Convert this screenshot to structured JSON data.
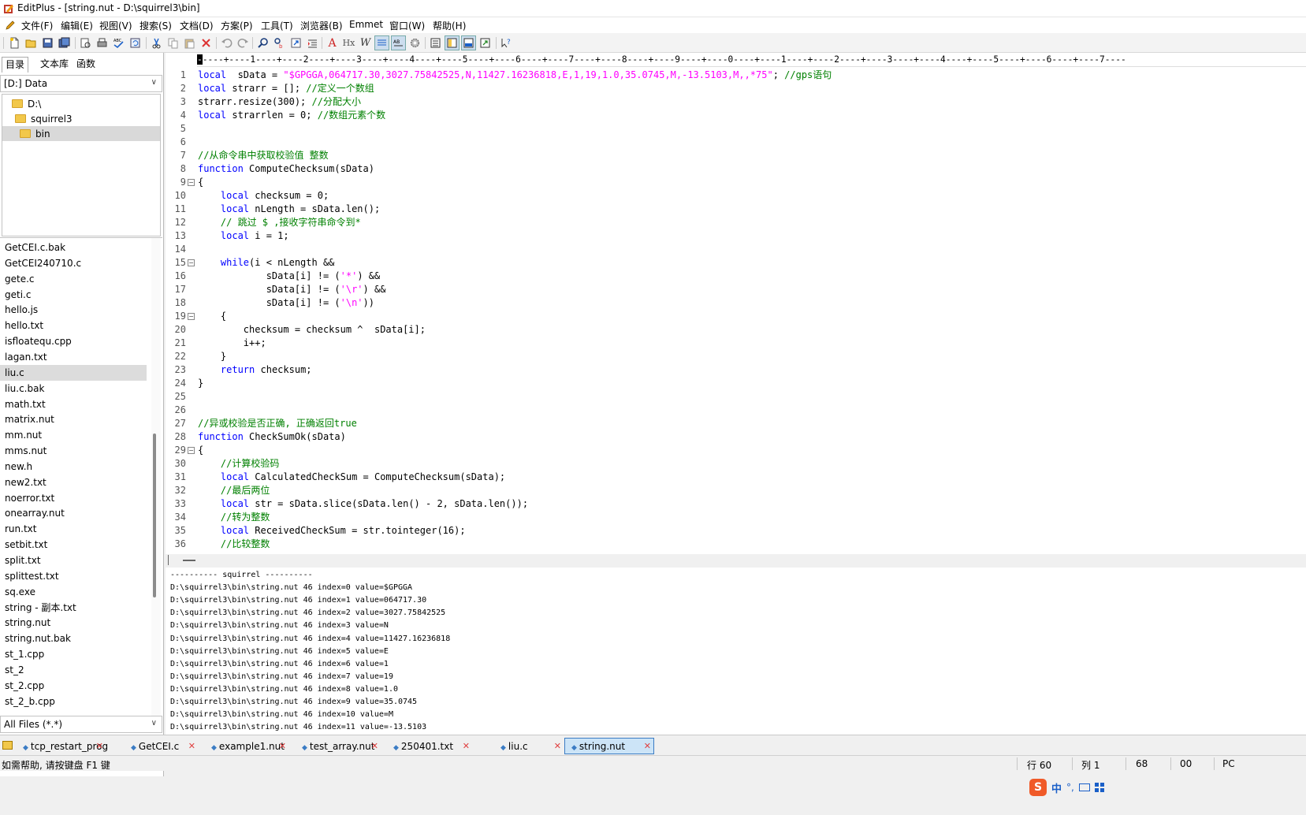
{
  "window": {
    "title": "EditPlus - [string.nut - D:\\squirrel3\\bin]"
  },
  "menu": [
    "文件(F)",
    "编辑(E)",
    "视图(V)",
    "搜索(S)",
    "文档(D)",
    "方案(P)",
    "工具(T)",
    "浏览器(B)",
    "Emmet",
    "窗口(W)",
    "帮助(H)"
  ],
  "toolbar": {
    "icons": [
      "new-file-icon",
      "open-file-icon",
      "save-icon",
      "save-all-icon",
      "print-preview-icon",
      "print-icon",
      "spellcheck-icon",
      "refresh-icon",
      "cut-icon",
      "copy-icon",
      "paste-icon",
      "delete-icon",
      "undo-icon",
      "redo-icon",
      "find-icon",
      "replace-icon",
      "goto-icon",
      "indent-icon",
      "font-icon",
      "hex-icon",
      "word-wrap-icon",
      "line-number-icon",
      "ruler-icon",
      "settings-icon",
      "cliptext-icon",
      "directory-icon",
      "output-icon",
      "fullscreen-icon",
      "help-icon"
    ],
    "labels": {
      "font": "A",
      "hex": "Hx",
      "wrap": "W"
    }
  },
  "left": {
    "tabs": [
      "目录",
      "文本库",
      "函数"
    ],
    "drive": "[D:] Data",
    "tree": [
      {
        "label": "D:\\"
      },
      {
        "label": "squirrel3"
      },
      {
        "label": "bin"
      }
    ],
    "files": [
      "GetCEI.c.bak",
      "GetCEI240710.c",
      "gete.c",
      "geti.c",
      "hello.js",
      "hello.txt",
      "isfloatequ.cpp",
      "lagan.txt",
      "liu.c",
      "liu.c.bak",
      "math.txt",
      "matrix.nut",
      "mm.nut",
      "mms.nut",
      "new.h",
      "new2.txt",
      "noerror.txt",
      "onearray.nut",
      "run.txt",
      "setbit.txt",
      "split.txt",
      "splittest.txt",
      "sq.exe",
      "string - 副本.txt",
      "string.nut",
      "string.nut.bak",
      "st_1.cpp",
      "st_2",
      "st_2.cpp",
      "st_2_b.cpp"
    ],
    "selected_file": "liu.c",
    "filter": "All Files (*.*)"
  },
  "editor": {
    "ruler": "----+----1----+----2----+----3----+----4----+----5----+----6----+----7----+----8----+----9----+----0----+----1----+----2----+----3----+----4----+----5----+----6----+----7----",
    "lines": [
      [
        [
          "kw",
          "local"
        ],
        [
          "",
          "  sData = "
        ],
        [
          "str",
          "\"$GPGGA,064717.30,3027.75842525,N,11427.16236818,E,1,19,1.0,35.0745,M,-13.5103,M,,*75\""
        ],
        [
          "",
          "; "
        ],
        [
          "cm",
          "//gps语句"
        ]
      ],
      [
        [
          "kw",
          "local"
        ],
        [
          "",
          " strarr = []; "
        ],
        [
          "cm",
          "//定义一个数组"
        ]
      ],
      [
        [
          "",
          "strarr.resize(300); "
        ],
        [
          "cm",
          "//分配大小"
        ]
      ],
      [
        [
          "kw",
          "local"
        ],
        [
          "",
          " strarrlen = 0; "
        ],
        [
          "cm",
          "//数组元素个数"
        ]
      ],
      [],
      [],
      [
        [
          "cm",
          "//从命令串中获取校验值 整数"
        ]
      ],
      [
        [
          "kw",
          "function"
        ],
        [
          "",
          " ComputeChecksum(sData)"
        ]
      ],
      [
        [
          "",
          "{"
        ]
      ],
      [
        [
          "",
          "    "
        ],
        [
          "kw",
          "local"
        ],
        [
          "",
          " checksum = 0;"
        ]
      ],
      [
        [
          "",
          "    "
        ],
        [
          "kw",
          "local"
        ],
        [
          "",
          " nLength = sData.len();"
        ]
      ],
      [
        [
          "",
          "    "
        ],
        [
          "cm",
          "// 跳过 $ ,接收字符串命令到*"
        ]
      ],
      [
        [
          "",
          "    "
        ],
        [
          "kw",
          "local"
        ],
        [
          "",
          " i = 1;"
        ]
      ],
      [],
      [
        [
          "",
          "    "
        ],
        [
          "kw",
          "while"
        ],
        [
          "",
          "(i < nLength &&"
        ]
      ],
      [
        [
          "",
          "            sData[i] != ("
        ],
        [
          "str",
          "'*'"
        ],
        [
          "",
          ") &&"
        ]
      ],
      [
        [
          "",
          "            sData[i] != ("
        ],
        [
          "str",
          "'\\r'"
        ],
        [
          "",
          ") &&"
        ]
      ],
      [
        [
          "",
          "            sData[i] != ("
        ],
        [
          "str",
          "'\\n'"
        ],
        [
          "",
          "))"
        ]
      ],
      [
        [
          "",
          "    {"
        ]
      ],
      [
        [
          "",
          "        checksum = checksum ^  sData[i];"
        ]
      ],
      [
        [
          "",
          "        i++;"
        ]
      ],
      [
        [
          "",
          "    }"
        ]
      ],
      [
        [
          "",
          "    "
        ],
        [
          "kw",
          "return"
        ],
        [
          "",
          " checksum;"
        ]
      ],
      [
        [
          "",
          "}"
        ]
      ],
      [],
      [],
      [
        [
          "cm",
          "//异或校验是否正确, 正确返回true"
        ]
      ],
      [
        [
          "kw",
          "function"
        ],
        [
          "",
          " CheckSumOk(sData)"
        ]
      ],
      [
        [
          "",
          "{"
        ]
      ],
      [
        [
          "",
          "    "
        ],
        [
          "cm",
          "//计算校验码"
        ]
      ],
      [
        [
          "",
          "    "
        ],
        [
          "kw",
          "local"
        ],
        [
          "",
          " CalculatedCheckSum = ComputeChecksum(sData);"
        ]
      ],
      [
        [
          "",
          "    "
        ],
        [
          "cm",
          "//最后两位"
        ]
      ],
      [
        [
          "",
          "    "
        ],
        [
          "kw",
          "local"
        ],
        [
          "",
          " str = sData.slice(sData.len() - 2, sData.len());"
        ]
      ],
      [
        [
          "",
          "    "
        ],
        [
          "cm",
          "//转为整数"
        ]
      ],
      [
        [
          "",
          "    "
        ],
        [
          "kw",
          "local"
        ],
        [
          "",
          " ReceivedCheckSum = str.tointeger(16);"
        ]
      ],
      [
        [
          "",
          "    "
        ],
        [
          "cm",
          "//比较整数"
        ]
      ]
    ],
    "fold_lines": [
      9,
      15,
      19,
      29
    ]
  },
  "output": [
    "---------- squirrel ----------",
    "D:\\squirrel3\\bin\\string.nut 46 index=0 value=$GPGGA",
    "D:\\squirrel3\\bin\\string.nut 46 index=1 value=064717.30",
    "D:\\squirrel3\\bin\\string.nut 46 index=2 value=3027.75842525",
    "D:\\squirrel3\\bin\\string.nut 46 index=3 value=N",
    "D:\\squirrel3\\bin\\string.nut 46 index=4 value=11427.16236818",
    "D:\\squirrel3\\bin\\string.nut 46 index=5 value=E",
    "D:\\squirrel3\\bin\\string.nut 46 index=6 value=1",
    "D:\\squirrel3\\bin\\string.nut 46 index=7 value=19",
    "D:\\squirrel3\\bin\\string.nut 46 index=8 value=1.0",
    "D:\\squirrel3\\bin\\string.nut 46 index=9 value=35.0745",
    "D:\\squirrel3\\bin\\string.nut 46 index=10 value=M",
    "D:\\squirrel3\\bin\\string.nut 46 index=11 value=-13.5103"
  ],
  "tabs": [
    {
      "label": "tcp_restart_prog",
      "active": false
    },
    {
      "label": "GetCEI.c",
      "active": false
    },
    {
      "label": "example1.nut",
      "active": false
    },
    {
      "label": "test_array.nut",
      "active": false
    },
    {
      "label": "250401.txt",
      "active": false
    },
    {
      "label": "liu.c",
      "active": false
    },
    {
      "label": "string.nut",
      "active": true
    }
  ],
  "status": {
    "help": "如需帮助, 请按键盘 F1 键",
    "row": "行 60",
    "col": "列 1",
    "v1": "68",
    "v2": "00",
    "mode": "PC"
  },
  "ime": {
    "lang": "中",
    "punct": "°,"
  },
  "colors": {
    "keyword": "#0000ff",
    "string": "#ff00ff",
    "comment": "#008000",
    "active_tab": "#cce4f7"
  }
}
